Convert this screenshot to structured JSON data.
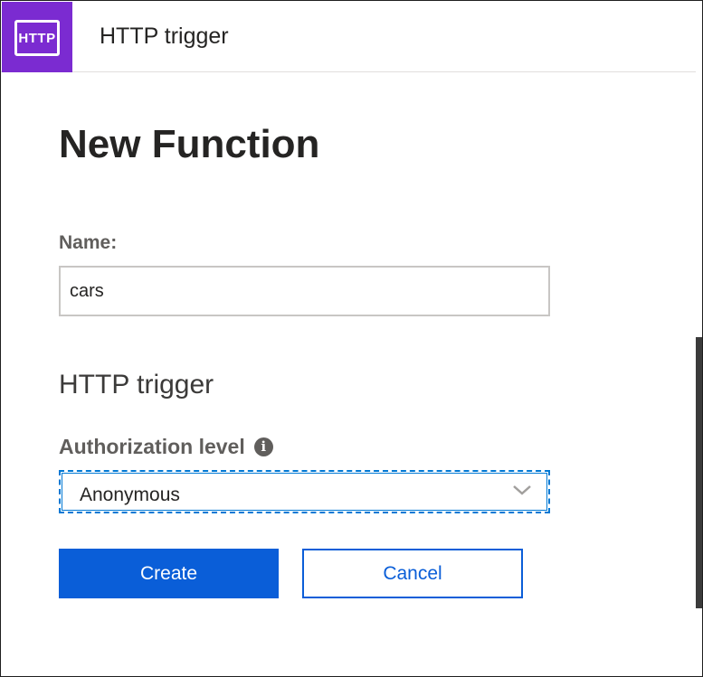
{
  "header": {
    "logo_text": "HTTP",
    "title": "HTTP trigger"
  },
  "page": {
    "title": "New Function"
  },
  "name_field": {
    "label": "Name:",
    "value": "cars"
  },
  "section": {
    "heading": "HTTP trigger"
  },
  "authorization": {
    "label": "Authorization level",
    "info_icon": "info-icon",
    "selected": "Anonymous",
    "dropdown_icon": "chevron-down-icon"
  },
  "actions": {
    "create_label": "Create",
    "cancel_label": "Cancel"
  },
  "colors": {
    "brand_purple": "#7b2bd1",
    "accent_blue": "#0a5ed8",
    "focus_blue": "#0078d4"
  }
}
